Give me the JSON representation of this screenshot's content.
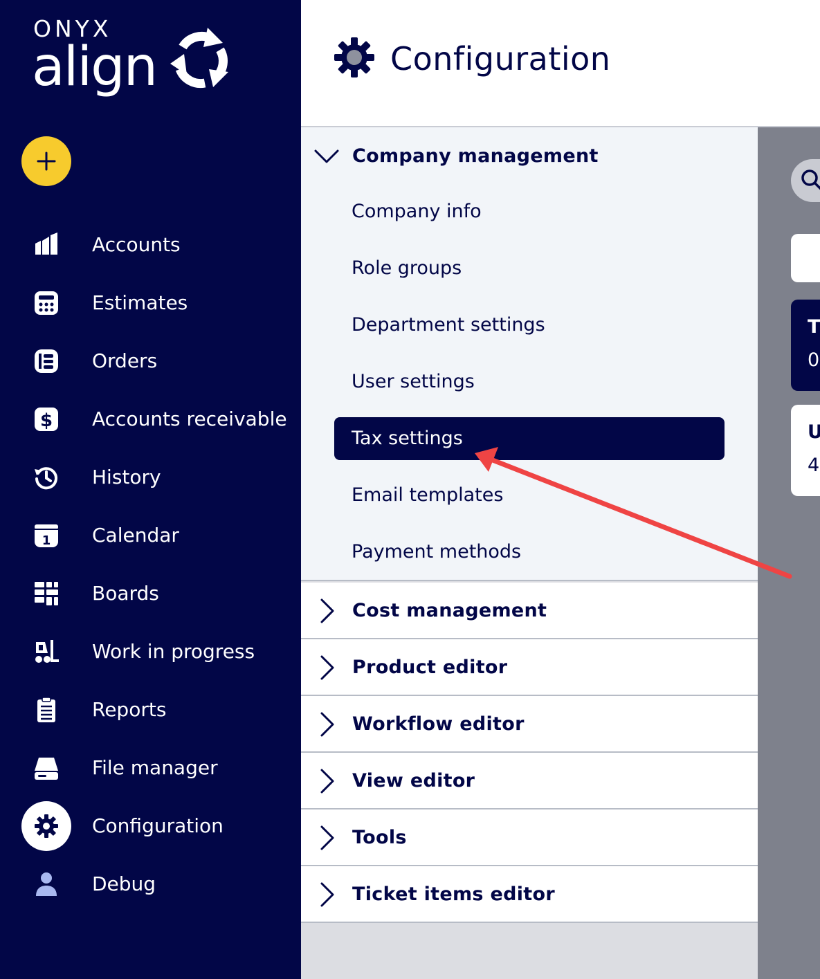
{
  "brand": {
    "top": "ONYX",
    "bottom": "align"
  },
  "sidebar": {
    "add_button_icon": "plus-icon",
    "items": [
      {
        "label": "Accounts",
        "icon": "factory-icon"
      },
      {
        "label": "Estimates",
        "icon": "calculator-icon"
      },
      {
        "label": "Orders",
        "icon": "orders-icon"
      },
      {
        "label": "Accounts receivable",
        "icon": "dollar-icon"
      },
      {
        "label": "History",
        "icon": "history-icon"
      },
      {
        "label": "Calendar",
        "icon": "calendar-icon"
      },
      {
        "label": "Boards",
        "icon": "boards-icon"
      },
      {
        "label": "Work in progress",
        "icon": "forklift-icon"
      },
      {
        "label": "Reports",
        "icon": "clipboard-icon"
      },
      {
        "label": "File manager",
        "icon": "drive-icon"
      },
      {
        "label": "Configuration",
        "icon": "gear-icon",
        "active": true
      },
      {
        "label": "Debug",
        "icon": "user-icon"
      }
    ],
    "calendar_day": "1"
  },
  "header": {
    "title": "Configuration",
    "icon": "gear-icon"
  },
  "config": {
    "open_section": {
      "label": "Company management",
      "items": [
        {
          "label": "Company info"
        },
        {
          "label": "Role groups"
        },
        {
          "label": "Department settings"
        },
        {
          "label": "User settings"
        },
        {
          "label": "Tax settings",
          "selected": true
        },
        {
          "label": "Email templates"
        },
        {
          "label": "Payment methods"
        }
      ]
    },
    "closed_sections": [
      {
        "label": "Cost management"
      },
      {
        "label": "Product editor"
      },
      {
        "label": "Workflow editor"
      },
      {
        "label": "View editor"
      },
      {
        "label": "Tools"
      },
      {
        "label": "Ticket items editor"
      }
    ]
  },
  "right_panel": {
    "card_navy": {
      "title": "T",
      "value": "0"
    },
    "card_white": {
      "title": "U",
      "value": "4"
    }
  },
  "colors": {
    "sidebar_bg": "#020647",
    "accent_yellow": "#f7cb2d",
    "selected_bg": "#020647",
    "annotation_arrow": "#ef4444"
  }
}
